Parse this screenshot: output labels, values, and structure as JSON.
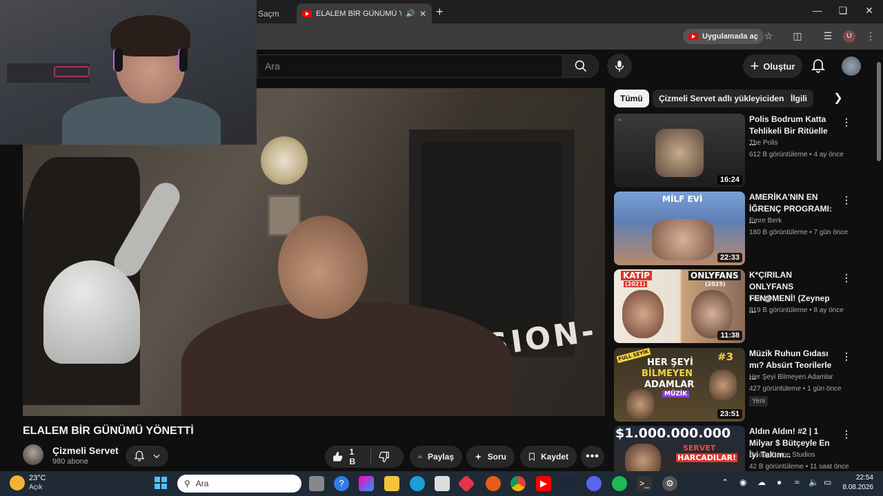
{
  "browser": {
    "tab_partial": "Saçm",
    "tab_active": "ELALEM BİR GÜNÜMÜ YÖN",
    "open_in_app": "Uygulamada aç",
    "profile_initial": "U"
  },
  "masthead": {
    "search_placeholder": "Ara",
    "create_label": "Oluştur"
  },
  "video": {
    "overlay_text": "-VISION-",
    "title": "ELALEM BİR GÜNÜMÜ YÖNETTİ",
    "channel": "Çizmeli Servet",
    "subscribers": "980 abone",
    "likes": "1 B",
    "share_label": "Paylaş",
    "ask_label": "Soru",
    "save_label": "Kaydet"
  },
  "chips": [
    "Tümü",
    "Çizmeli Servet adlı yükleyiciden",
    "İlgili"
  ],
  "recommendations": [
    {
      "title": "Polis Bodrum Katta Tehlikeli Bir Ritüelle ...",
      "channel": "The Polis",
      "meta": "612 B görüntüleme • 4 ay önce",
      "duration": "16:24",
      "badge": ""
    },
    {
      "title": "AMERİKA'NIN EN İĞRENÇ PROGRAMI: ...",
      "channel": "Emre Berk",
      "meta": "180 B görüntüleme • 7 gün önce",
      "duration": "22:33",
      "badge": "",
      "thumb_text": "MİLF EVİ"
    },
    {
      "title": "K*ÇIRILAN ONLYFANS FENOMENİ! (Zeynep ...",
      "channel": "Tuni",
      "meta": "819 B görüntüleme • 8 ay önce",
      "duration": "11:38",
      "badge": "",
      "thumb_text_1": "KATİP",
      "thumb_text_1b": "(2021)",
      "thumb_text_2": "ONLYFANS",
      "thumb_text_2b": "(2025)"
    },
    {
      "title": "Müzik Ruhun Gıdası mı? Absürt Teorilerle ...",
      "channel": "Her Şeyi Bilmeyen Adamlar",
      "meta": "427 görüntüleme • 1 gün önce",
      "duration": "23:51",
      "badge": "Yeni",
      "thumb_text_1": "HER ŞEYİ",
      "thumb_text_2": "BİLMEYEN",
      "thumb_text_3": "ADAMLAR",
      "thumb_text_4": "MÜZİK",
      "thumb_text_5": "#3",
      "thumb_text_6": "FULL SEYİK"
    },
    {
      "title": "Aldın Aldın! #2 | 1 Milyar $ Bütçeyle En İyi Takım...",
      "channel": "Griddy Game Studios",
      "meta": "42 B görüntüleme • 11 saat önce",
      "duration": "",
      "badge": "",
      "thumb_text_1": "$1.000.000.000",
      "thumb_text_2": "SERVET",
      "thumb_text_3": "HARCADILAR!"
    }
  ],
  "taskbar": {
    "temp": "23°C",
    "weather": "Açık",
    "search_placeholder": "Ara",
    "time": "22:54",
    "date": "8.08.2026"
  },
  "colors": {
    "youtube_red": "#ff0000",
    "bg": "#0f0f0f",
    "chip_bg": "#272727"
  }
}
